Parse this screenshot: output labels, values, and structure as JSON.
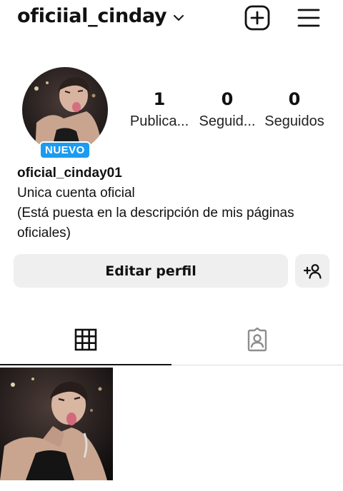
{
  "header": {
    "username": "oficiial_cinday",
    "icons": [
      "chevron-down-icon",
      "add-post-icon",
      "hamburger-menu-icon"
    ]
  },
  "profile": {
    "badge": "NUEVO",
    "stats": [
      {
        "value": "1",
        "label": "Publica..."
      },
      {
        "value": "0",
        "label": "Seguid..."
      },
      {
        "value": "0",
        "label": "Seguidos"
      }
    ]
  },
  "bio": {
    "handle": "oficial_cinday01",
    "line1": "Unica cuenta oficial",
    "line2": "(Está puesta en la descripción de mis páginas",
    "line3": "oficiales)"
  },
  "actions": {
    "edit_label": "Editar perfil",
    "add_icon": "add-person-icon"
  },
  "tabs": [
    {
      "icon": "grid-icon",
      "active": true
    },
    {
      "icon": "tagged-photos-icon",
      "active": false
    }
  ],
  "posts_count": 1,
  "colors": {
    "badge": "#1d9bf0",
    "button_bg": "#efefef",
    "divider": "#dbdbdb"
  }
}
